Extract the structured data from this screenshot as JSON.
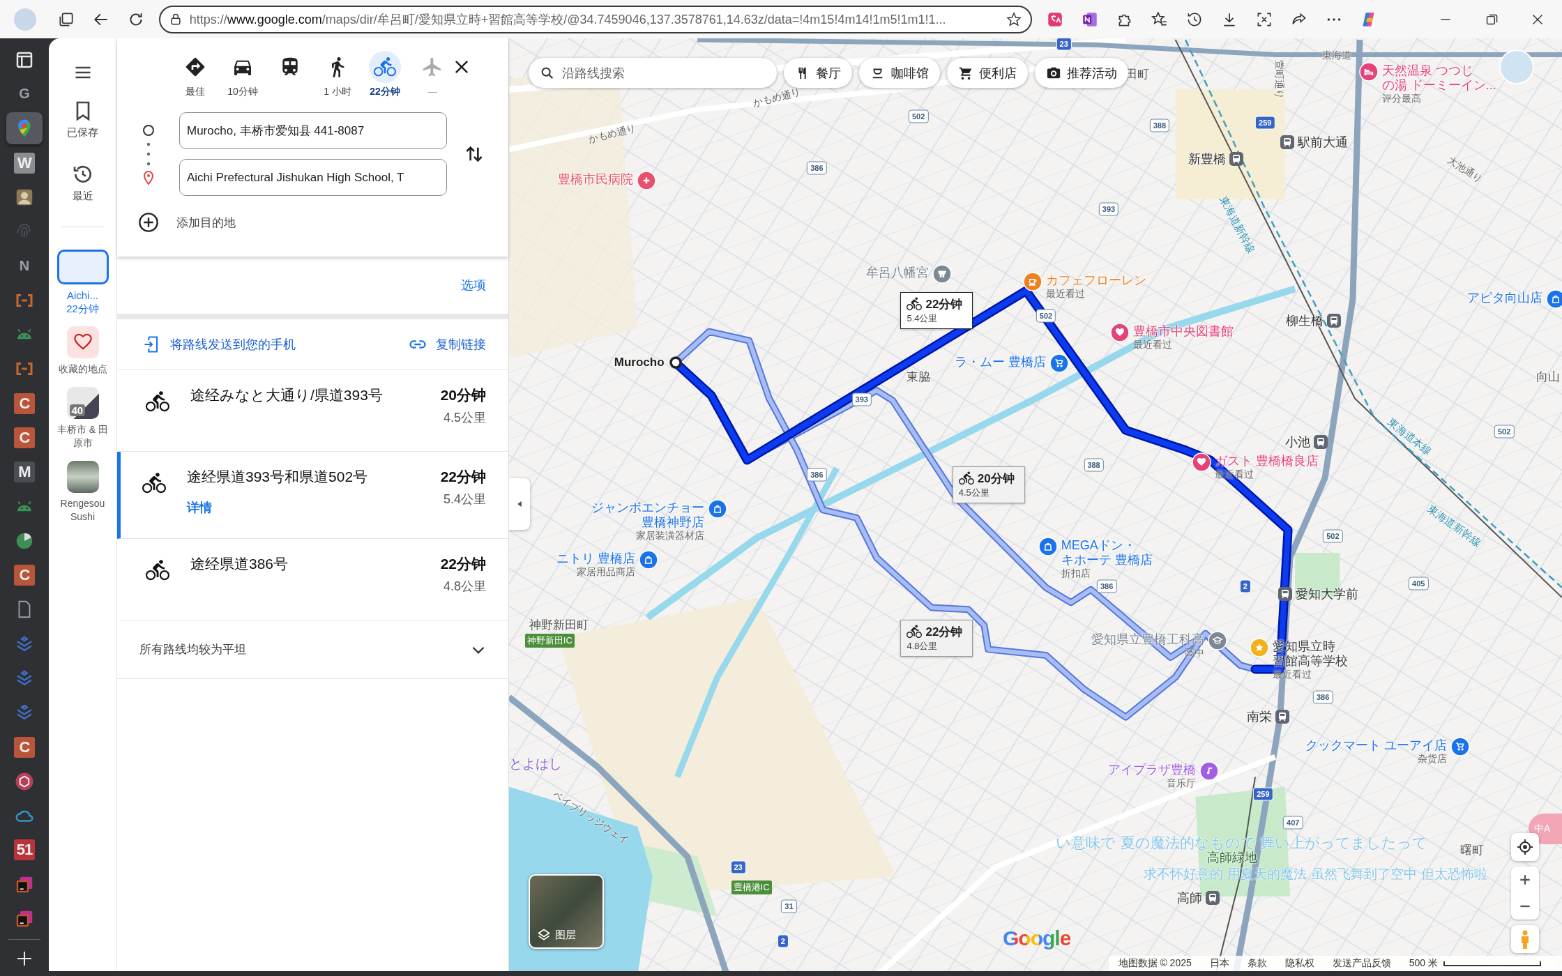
{
  "browser": {
    "url": "https://**www.google.com**/maps/dir/牟呂町/愛知県立時+習館高等学校/@34.7459046,137.3578761,14.63z/data=!4m15!4m14!1m5!1m1!1...",
    "sidebar_apps": [
      {
        "kind": "tabs",
        "selected": false
      },
      {
        "kind": "letter",
        "glyph": "G",
        "color": "#9aa0a6",
        "selected": false
      },
      {
        "kind": "maps",
        "selected": true
      },
      {
        "kind": "tile",
        "glyph": "W",
        "color": "#8a8d91",
        "selected": false
      },
      {
        "kind": "avatar",
        "color": "#8c7a57",
        "selected": false
      },
      {
        "kind": "fingerprint",
        "color": "#4a4d52",
        "selected": false
      },
      {
        "kind": "letter",
        "glyph": "N",
        "color": "#9aa0a6",
        "selected": false
      },
      {
        "kind": "bracket",
        "color": "#c46a2e",
        "selected": false
      },
      {
        "kind": "android",
        "color": "#3f8f55",
        "selected": false
      },
      {
        "kind": "bracket",
        "color": "#c46a2e",
        "selected": false
      },
      {
        "kind": "tile",
        "glyph": "C",
        "color": "#b8553a",
        "selected": false
      },
      {
        "kind": "tile",
        "glyph": "C",
        "color": "#b8553a",
        "selected": false
      },
      {
        "kind": "tile",
        "glyph": "M",
        "color": "#4a4d52",
        "selected": false
      },
      {
        "kind": "android",
        "color": "#3f8f55",
        "selected": false
      },
      {
        "kind": "pie",
        "color": "#3f8f55",
        "selected": false
      },
      {
        "kind": "tile",
        "glyph": "C",
        "color": "#b8553a",
        "selected": false
      },
      {
        "kind": "doc",
        "color": "#9aa0a6",
        "selected": false
      },
      {
        "kind": "layers",
        "color": "#3f6fc4",
        "selected": false
      },
      {
        "kind": "layers",
        "color": "#3f6fc4",
        "selected": false
      },
      {
        "kind": "layers",
        "color": "#3f6fc4",
        "selected": false
      },
      {
        "kind": "tile",
        "glyph": "C",
        "color": "#b8553a",
        "selected": false
      },
      {
        "kind": "cube",
        "color": "#b5405b",
        "selected": false
      },
      {
        "kind": "cloud",
        "color": "#3595c8",
        "selected": false
      },
      {
        "kind": "tile",
        "glyph": "51",
        "color": "#b8333a",
        "selected": false
      },
      {
        "kind": "terminal",
        "color": "#c0532a",
        "selected": false
      },
      {
        "kind": "terminal",
        "color": "#c0532a",
        "selected": false
      }
    ]
  },
  "rail": {
    "items": [
      {
        "kind": "saved",
        "label": "已保存"
      },
      {
        "kind": "recent",
        "label": "最近"
      }
    ],
    "places": [
      {
        "kind": "route",
        "title": "Aichi...",
        "subtitle": "22分钟",
        "selected": true
      },
      {
        "kind": "favorites",
        "title": "收藏的地点",
        "selected": false
      },
      {
        "kind": "map",
        "badge": "40",
        "title": "丰桥市 & 田原市",
        "selected": false
      },
      {
        "kind": "photo",
        "title": "Rengesou Sushi",
        "selected": false
      }
    ]
  },
  "directions": {
    "modes": [
      {
        "kind": "best",
        "label": "最佳",
        "selected": false,
        "disabled": false
      },
      {
        "kind": "car",
        "label": "10分钟",
        "selected": false,
        "disabled": false
      },
      {
        "kind": "transit",
        "selected": false,
        "disabled": false
      },
      {
        "kind": "walk",
        "label": "1 小时",
        "selected": false,
        "disabled": false
      },
      {
        "kind": "bike",
        "label": "22分钟",
        "selected": true,
        "disabled": false
      },
      {
        "kind": "flight",
        "label": "—",
        "selected": false,
        "disabled": true
      }
    ],
    "origin": "Murocho, 丰桥市爱知县 441-8087",
    "destination": "Aichi Prefectural Jishukan High School, T",
    "add_destination": "添加目的地",
    "options": "选项",
    "send_to_phone": "将路线发送到您的手机",
    "copy_link": "复制链接",
    "routes": [
      {
        "title": "途经みなと大通り/県道393号",
        "time": "20分钟",
        "distance": "4.5公里",
        "selected": false
      },
      {
        "title": "途经県道393号和県道502号",
        "time": "22分钟",
        "distance": "5.4公里",
        "selected": true,
        "details": "详情"
      },
      {
        "title": "途经県道386号",
        "time": "22分钟",
        "distance": "4.8公里",
        "selected": false
      }
    ],
    "elevation": {
      "text": "所有路线均较为平坦",
      "expanded": false
    }
  },
  "map": {
    "search_placeholder": "沿路线搜索",
    "chips": [
      {
        "kind": "restaurant",
        "label": "餐厅"
      },
      {
        "kind": "cafe",
        "label": "咖啡馆"
      },
      {
        "kind": "store",
        "label": "便利店"
      },
      {
        "kind": "camera",
        "label": "推荐活动"
      }
    ],
    "origin_label": "Murocho",
    "callouts": [
      {
        "time": "20分钟",
        "distance": "4.5公里",
        "selected": false
      },
      {
        "time": "22分钟",
        "distance": "5.4公里",
        "selected": true
      },
      {
        "time": "22分钟",
        "distance": "4.8公里",
        "selected": false
      }
    ],
    "places": [
      {
        "kind": "hospital",
        "lines": [
          "豊橋市民病院"
        ],
        "color": "#e8506c"
      },
      {
        "kind": "shrine",
        "lines": [
          "牟呂八幡宮"
        ],
        "color": "#7d8893"
      },
      {
        "kind": "cafe",
        "lines": [
          "カフェフローレン"
        ],
        "sub": "最近看过",
        "color": "#f0811f"
      },
      {
        "kind": "heart",
        "lines": [
          "豊橋市中央図書館"
        ],
        "sub": "最近看过",
        "color": "#e5427a"
      },
      {
        "kind": "cart",
        "lines": [
          "ラ・ムー 豊橋店"
        ],
        "color": "#1a73e8"
      },
      {
        "kind": "heart",
        "lines": [
          "ガスト 豊橋橋良店"
        ],
        "sub": "最近看过",
        "color": "#e5427a"
      },
      {
        "kind": "bag",
        "lines": [
          "ジャンボエンチョー",
          "豊橋神野店"
        ],
        "sub": "家居装潢器材店",
        "color": "#1a73e8"
      },
      {
        "kind": "bag",
        "lines": [
          "ニトリ 豊橋店"
        ],
        "sub": "家居用品商店",
        "color": "#1a73e8"
      },
      {
        "kind": "bag",
        "lines": [
          "MEGAドン・",
          "キホーテ 豊橋店"
        ],
        "sub": "折扣店",
        "color": "#1a73e8"
      },
      {
        "kind": "school",
        "lines": [
          "愛知県立豊橋工科高"
        ],
        "sub": "高中",
        "color": "#7d8893"
      },
      {
        "kind": "star",
        "lines": [
          "愛知県立時",
          "習館高等学校"
        ],
        "sub": "最近看过",
        "color": "#f2b21b"
      },
      {
        "kind": "cart",
        "lines": [
          "クックマート ユーアイ店"
        ],
        "sub": "杂货店",
        "color": "#1a73e8"
      },
      {
        "kind": "music",
        "lines": [
          "アイプラザ豊橋"
        ],
        "sub": "音乐厅",
        "color": "#a25ee0"
      },
      {
        "kind": "bag",
        "lines": [
          "アピタ向山店"
        ],
        "color": "#1a73e8"
      },
      {
        "kind": "hotel",
        "lines": [
          "天然温泉 つつじ",
          "の湯 ドーミーイン..."
        ],
        "sub": "评分最高",
        "color": "#e5427a"
      }
    ],
    "labels": [
      {
        "kind": "area",
        "text": "田町"
      },
      {
        "kind": "road",
        "text": "東海道"
      },
      {
        "kind": "road",
        "text": "かもめ通り"
      },
      {
        "kind": "road",
        "text": "かもめ通り"
      },
      {
        "kind": "road",
        "text": "萱町通り"
      },
      {
        "kind": "road",
        "text": "大池通り"
      },
      {
        "kind": "rail",
        "text": "東海道新幹線"
      },
      {
        "kind": "rail",
        "text": "東海道本線"
      },
      {
        "kind": "rail",
        "text": "東海道新幹線"
      },
      {
        "kind": "station",
        "text": "新豊橋"
      },
      {
        "kind": "station",
        "text": "駅前大通"
      },
      {
        "kind": "station",
        "text": "柳生橋"
      },
      {
        "kind": "station",
        "text": "小池"
      },
      {
        "kind": "station",
        "text": "愛知大学前"
      },
      {
        "kind": "station",
        "text": "南栄"
      },
      {
        "kind": "station",
        "text": "高師"
      },
      {
        "kind": "area",
        "text": "東脇"
      },
      {
        "kind": "area",
        "text": "向山"
      },
      {
        "kind": "area",
        "text": "曙町"
      },
      {
        "kind": "area",
        "text": "神野新田町"
      },
      {
        "kind": "ic",
        "text": "神野新田IC"
      },
      {
        "kind": "ic",
        "text": "豊橋港IC"
      },
      {
        "kind": "city",
        "text": "とよはし"
      },
      {
        "kind": "park",
        "text": "高師緑地"
      },
      {
        "kind": "road",
        "text": "ベイブリッジウェイ"
      }
    ],
    "shields": [
      {
        "kind": "national",
        "number": "23"
      },
      {
        "kind": "pref",
        "number": "502"
      },
      {
        "kind": "pref",
        "number": "388"
      },
      {
        "kind": "pref",
        "number": "386"
      },
      {
        "kind": "pref",
        "number": "393"
      },
      {
        "kind": "national",
        "number": "259"
      },
      {
        "kind": "pref",
        "number": "502"
      },
      {
        "kind": "pref",
        "number": "393"
      },
      {
        "kind": "pref",
        "number": "388"
      },
      {
        "kind": "pref",
        "number": "386"
      },
      {
        "kind": "pref",
        "number": "502"
      },
      {
        "kind": "pref",
        "number": "405"
      },
      {
        "kind": "pref",
        "number": "502"
      },
      {
        "kind": "pref",
        "number": "386"
      },
      {
        "kind": "national",
        "number": "2"
      },
      {
        "kind": "pref",
        "number": "386"
      },
      {
        "kind": "national",
        "number": "259"
      },
      {
        "kind": "pref",
        "number": "407"
      },
      {
        "kind": "national",
        "number": "23"
      },
      {
        "kind": "pref",
        "number": "31"
      },
      {
        "kind": "national",
        "number": "2"
      }
    ],
    "layers_label": "图层",
    "logo": "Google",
    "lyrics": [
      "い意味で 夏の魔法的なもので 舞い上がってましたって",
      "求不怀好意的 用夏天的魔法 虽然飞舞到了空中 但太恐怖啦"
    ],
    "translator_badge": "中A",
    "attribution": [
      "地图数据 © 2025",
      "日本",
      "条款",
      "隐私权",
      "发送产品反馈"
    ],
    "scale": "500 米"
  }
}
